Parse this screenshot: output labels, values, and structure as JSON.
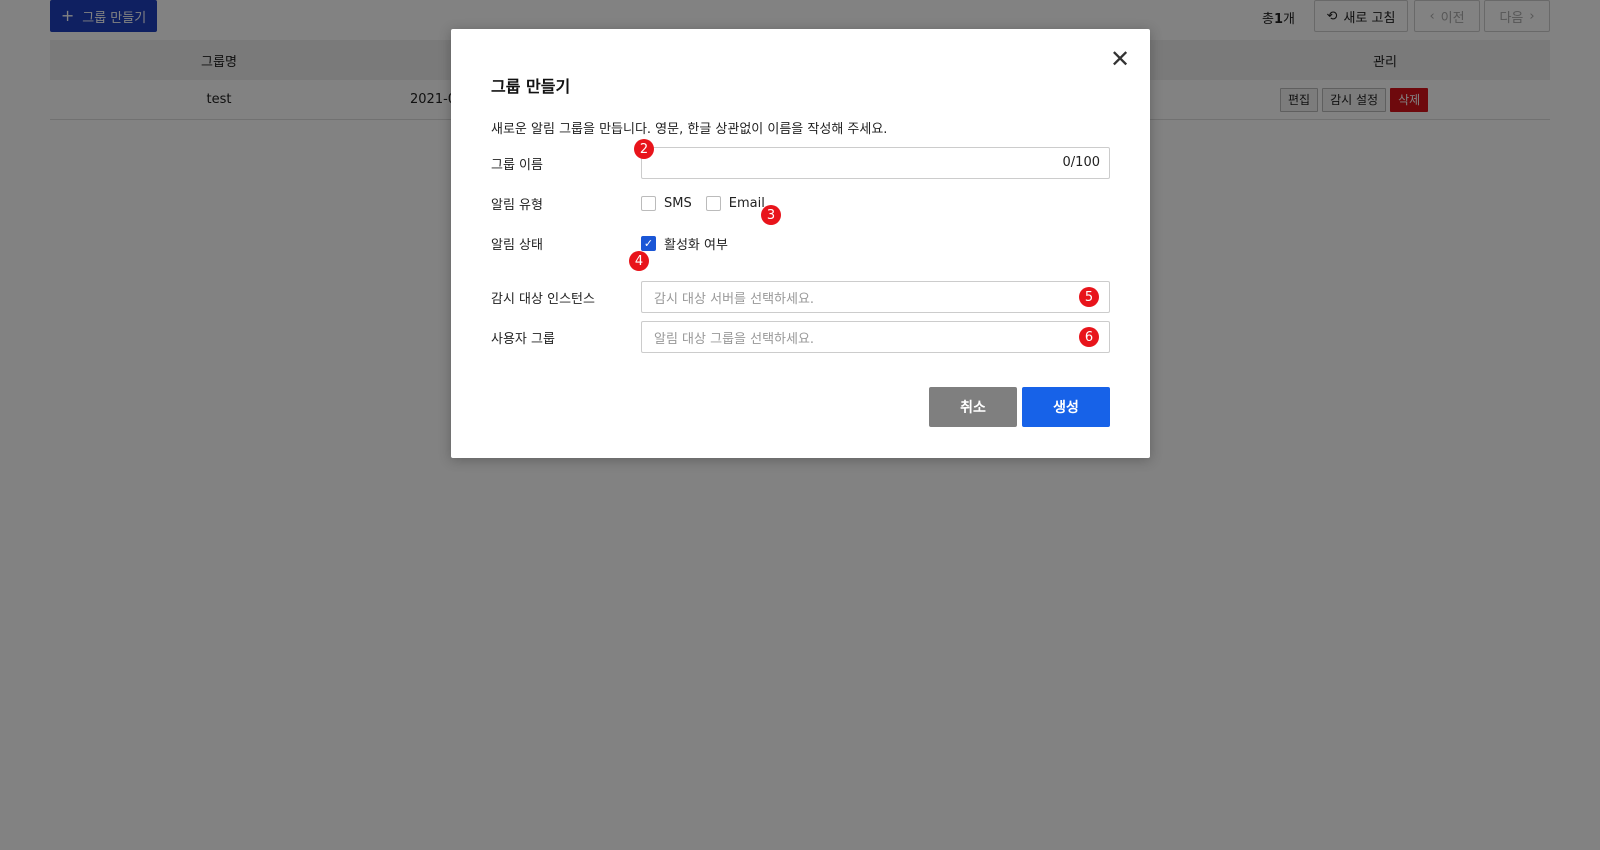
{
  "toolbar": {
    "create_label": "그룹 만들기",
    "create_icon": "plus-icon",
    "total_prefix": "총",
    "total_count": "1",
    "total_suffix": "개",
    "refresh_label": "새로 고침",
    "refresh_icon": "refresh-icon",
    "prev_label": "이전",
    "next_label": "다음"
  },
  "table": {
    "headers": {
      "name": "그룹명",
      "manage": "관리"
    },
    "rows": [
      {
        "name": "test",
        "date": "2021-0",
        "edit": "편집",
        "monitor": "감시 설정",
        "delete": "삭제"
      }
    ]
  },
  "modal": {
    "title": "그룹 만들기",
    "close_icon": "close-icon",
    "description": "새로운 알림 그룹을 만듭니다. 영문, 한글 상관없이 이름을 작성해 주세요.",
    "fields": {
      "group_name": {
        "label": "그룹 이름",
        "value": "",
        "counter": "0/100"
      },
      "alert_type": {
        "label": "알림 유형",
        "options": [
          "SMS",
          "Email"
        ],
        "checked": [
          false,
          false
        ]
      },
      "alert_status": {
        "label": "알림 상태",
        "option": "활성화 여부",
        "checked": true
      },
      "instances": {
        "label": "감시 대상 인스턴스",
        "placeholder": "감시 대상 서버를 선택하세요."
      },
      "user_group": {
        "label": "사용자 그룹",
        "placeholder": "알림 대상 그룹을 선택하세요."
      }
    },
    "cancel_label": "취소",
    "create_label": "생성"
  },
  "markers": [
    "2",
    "3",
    "4",
    "5",
    "6"
  ],
  "colors": {
    "primary": "#1762e8",
    "danger": "#d7121a",
    "marker": "#e8141b",
    "cancel": "#7f7f7f"
  }
}
